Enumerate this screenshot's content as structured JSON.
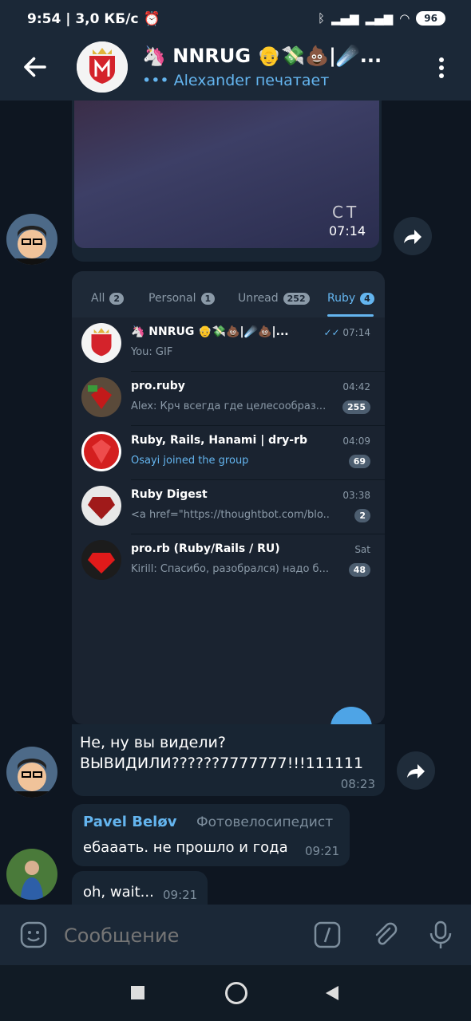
{
  "status_bar": {
    "time": "9:54",
    "speed": "3,0 КБ/с",
    "battery": "96"
  },
  "header": {
    "title": "🦄 NNRUG 👴💸💩|☄️...",
    "subtitle": "••• Alexander печатает"
  },
  "media1": {
    "watermark": "CT",
    "time": "07:14"
  },
  "forwarded_screenshot": {
    "tabs": [
      {
        "label": "All",
        "count": "2"
      },
      {
        "label": "Personal",
        "count": "1"
      },
      {
        "label": "Unread",
        "count": "252"
      },
      {
        "label": "Ruby",
        "count": "4"
      }
    ],
    "chats": [
      {
        "name": "🦄 NNRUG 👴💸💩|☄️💩|...",
        "time": "07:14",
        "preview": "You: GIF",
        "badge": ""
      },
      {
        "name": "pro.ruby",
        "time": "04:42",
        "preview": "Alex: Крч всегда где целесообраз...",
        "badge": "255"
      },
      {
        "name": "Ruby, Rails, Hanami | dry-rb",
        "time": "04:09",
        "preview": "Osayi joined the group",
        "badge": "69"
      },
      {
        "name": "Ruby Digest",
        "time": "03:38",
        "preview": "<a href=\"https://thoughtbot.com/blo...",
        "badge": "2"
      },
      {
        "name": "pro.rb (Ruby/Rails / RU)",
        "time": "Sat",
        "preview": "Kirill: Спасибо, разобрался) надо б...",
        "badge": "48"
      }
    ]
  },
  "message1": {
    "line1": "Не, ну вы видели?",
    "line2": "ВЫВИДИЛИ??????7777777!!!111111",
    "time": "08:23"
  },
  "message2": {
    "author": "Pavel Beløv",
    "role": "Фотовелосипедист",
    "text": "ебааать. не прошло и года",
    "time": "09:21"
  },
  "message3": {
    "text": "oh, wait...",
    "time": "09:21"
  },
  "input": {
    "placeholder": "Сообщение"
  },
  "colors": {
    "background": "#0e1621",
    "header": "#1b2837",
    "bubble": "#182533",
    "accent": "#64b5ef"
  }
}
